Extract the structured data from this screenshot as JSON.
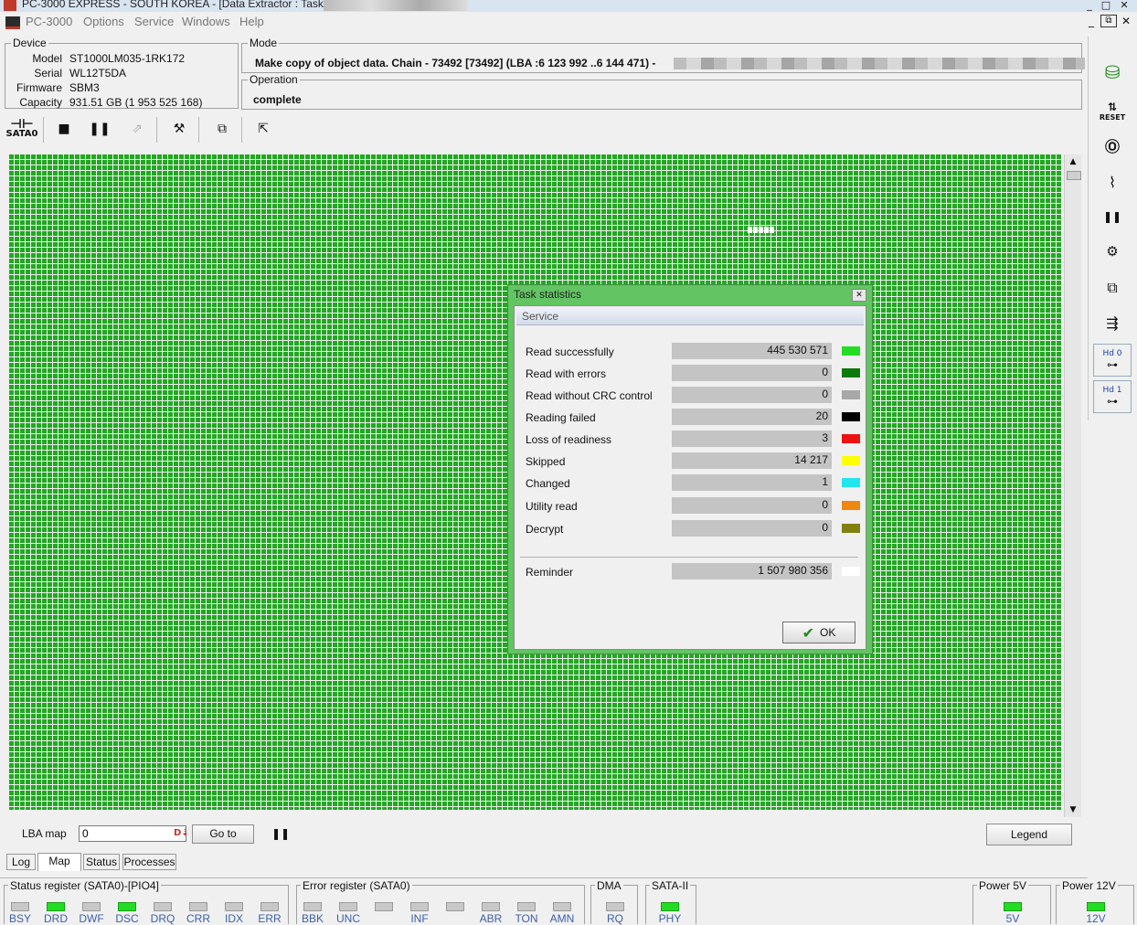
{
  "window": {
    "title": "PC-3000 EXPRESS - SOUTH KOREA - [Data Extractor : Task -",
    "controls": [
      "_",
      "□",
      "✕"
    ],
    "mdi_controls": [
      "_",
      "⧉",
      "✕"
    ]
  },
  "menu": [
    "PC-3000",
    "Options",
    "Service",
    "Windows",
    "Help"
  ],
  "device": {
    "label": "Device",
    "fields": [
      {
        "k": "Model",
        "v": "ST1000LM035-1RK172"
      },
      {
        "k": "Serial",
        "v": "WL12T5DA"
      },
      {
        "k": "Firmware",
        "v": "SBM3"
      },
      {
        "k": "Capacity",
        "v": "931.51 GB (1 953 525 168)"
      }
    ]
  },
  "mode": {
    "label": "Mode",
    "text": "Make copy of object data. Chain - 73492 [73492] (LBA :6 123 992 ..6 144 471) -"
  },
  "operation": {
    "label": "Operation",
    "text": "complete"
  },
  "toolbar": {
    "port_label": "SATA0"
  },
  "right_toolbar": {
    "reset_label": "RESET",
    "hd0_label": "Hd 0",
    "hd1_label": "Hd 1"
  },
  "map": {
    "cell_color": "#22a822"
  },
  "dialog": {
    "title": "Task statistics",
    "section": "Service",
    "rows": [
      {
        "label": "Read successfully",
        "value": "445 530 571",
        "color": "#22dd22"
      },
      {
        "label": "Read with errors",
        "value": "0",
        "color": "#0a7a0a"
      },
      {
        "label": "Read without CRC control",
        "value": "0",
        "color": "#a8a8a8"
      },
      {
        "label": "Reading failed",
        "value": "20",
        "color": "#000000"
      },
      {
        "label": "Loss of readiness",
        "value": "3",
        "color": "#ee1111"
      },
      {
        "label": "Skipped",
        "value": "14 217",
        "color": "#ffff00"
      },
      {
        "label": "Changed",
        "value": "1",
        "color": "#22e6ee"
      },
      {
        "label": "Utility read",
        "value": "0",
        "color": "#ee8811"
      },
      {
        "label": "Decrypt",
        "value": "0",
        "color": "#808010"
      }
    ],
    "reminder": {
      "label": "Reminder",
      "value": "1 507 980 356",
      "color": "#ffffff"
    },
    "ok_label": "OK"
  },
  "bottom": {
    "lba_label": "LBA map",
    "lba_value": "0",
    "goto_label": "Go to",
    "legend_label": "Legend",
    "tabs": [
      "Log",
      "Map",
      "Status",
      "Processes"
    ]
  },
  "registers": {
    "status": {
      "label": "Status register (SATA0)-[PIO4]",
      "leds": [
        {
          "name": "BSY",
          "on": false
        },
        {
          "name": "DRD",
          "on": true
        },
        {
          "name": "DWF",
          "on": false
        },
        {
          "name": "DSC",
          "on": true
        },
        {
          "name": "DRQ",
          "on": false
        },
        {
          "name": "CRR",
          "on": false
        },
        {
          "name": "IDX",
          "on": false
        },
        {
          "name": "ERR",
          "on": false
        }
      ]
    },
    "error": {
      "label": "Error register (SATA0)",
      "leds": [
        {
          "name": "BBK",
          "on": false
        },
        {
          "name": "UNC",
          "on": false
        },
        {
          "name": "",
          "on": false
        },
        {
          "name": "INF",
          "on": false
        },
        {
          "name": "",
          "on": false
        },
        {
          "name": "ABR",
          "on": false
        },
        {
          "name": "TON",
          "on": false
        },
        {
          "name": "AMN",
          "on": false
        }
      ]
    },
    "dma": {
      "label": "DMA",
      "leds": [
        {
          "name": "RQ",
          "on": false
        }
      ]
    },
    "sata": {
      "label": "SATA-II",
      "leds": [
        {
          "name": "PHY",
          "on": true
        }
      ]
    },
    "power5": {
      "label": "Power 5V",
      "leds": [
        {
          "name": "5V",
          "on": true
        }
      ]
    },
    "power12": {
      "label": "Power 12V",
      "leds": [
        {
          "name": "12V",
          "on": true
        }
      ]
    }
  }
}
